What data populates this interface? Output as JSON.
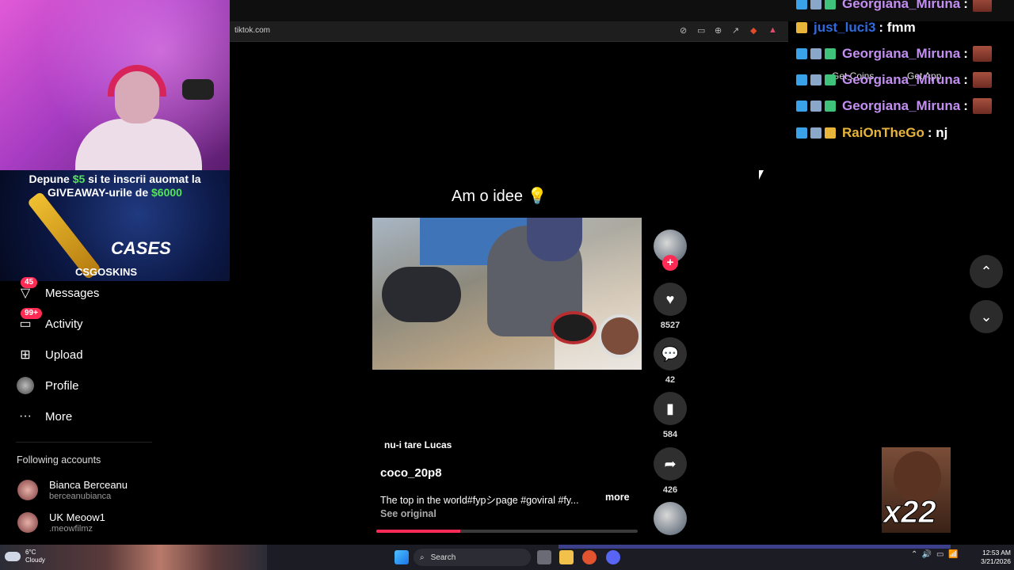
{
  "browser": {
    "url": "tiktok.com"
  },
  "promo": {
    "line1_a": "Depune ",
    "line1_amount": "$5",
    "line1_b": " si te inscrii auomat la",
    "line2_a": "GIVEAWAY-urile de ",
    "line2_amount": "$6000",
    "cases_label": "CASES",
    "brand": "CSGOSKINS"
  },
  "sidebar": {
    "items": [
      {
        "label": "Messages",
        "badge": "45",
        "icon": "messages-icon"
      },
      {
        "label": "Activity",
        "badge": "99+",
        "icon": "activity-icon"
      },
      {
        "label": "Upload",
        "icon": "upload-icon"
      },
      {
        "label": "Profile",
        "icon": "profile-avatar"
      },
      {
        "label": "More",
        "icon": "more-icon"
      }
    ],
    "following_heading": "Following accounts",
    "accounts": [
      {
        "name": "Bianca Berceanu",
        "handle": "berceanubianca"
      },
      {
        "name": "UK Meoow1",
        "handle": ".meowfilmz"
      }
    ]
  },
  "chat": {
    "messages": [
      {
        "user": "Georgiana_Miruna",
        "text": ":",
        "color": "#c38ff2"
      },
      {
        "user": "just_luci3",
        "text": ": fmm",
        "color": "#2f6bdc"
      },
      {
        "user": "Georgiana_Miruna",
        "text": ":",
        "color": "#c38ff2"
      },
      {
        "user": "Georgiana_Miruna",
        "text": ":",
        "color": "#c38ff2"
      },
      {
        "user": "Georgiana_Miruna",
        "text": ":",
        "color": "#c38ff2"
      },
      {
        "user": "RaiOnTheGo",
        "text": ": nj",
        "color": "#e7b43c"
      }
    ],
    "overlay_left": "Get Coins",
    "overlay_right": "Get App"
  },
  "video": {
    "title": "Am o idee 💡",
    "sound": "nu-i tare Lucas",
    "author": "coco_20p8",
    "description": "The top in the world#fypシpage #goviral #fy...",
    "more_label": "more",
    "see_original": "See original",
    "progress_fraction": 0.32,
    "likes": "8527",
    "comments": "42",
    "saves": "584",
    "shares": "426"
  },
  "overlay": {
    "emote_count": "x22"
  },
  "taskbar": {
    "weather_temp": "6°C",
    "weather_desc": "Cloudy",
    "search_label": "Search",
    "time": "12:53 AM",
    "date": "3/21/2026"
  },
  "colors": {
    "accent": "#fe2c55",
    "promo_green": "#54e35a"
  }
}
